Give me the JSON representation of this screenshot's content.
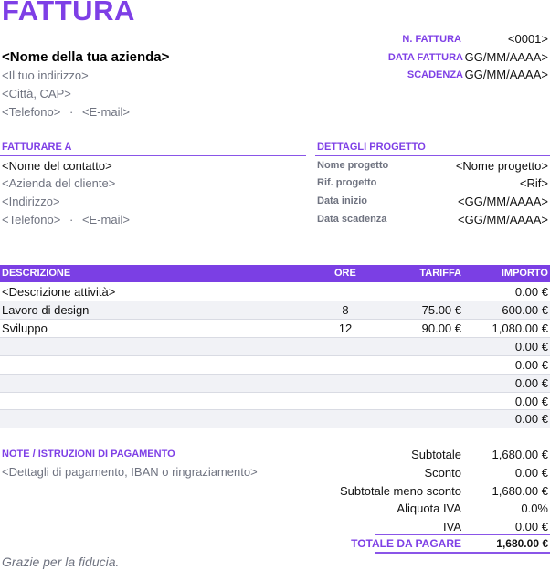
{
  "header": {
    "title": "FATTURA"
  },
  "company": {
    "name": "<Nome della tua azienda>",
    "address": "<Il tuo indirizzo>",
    "city": "<Città, CAP>",
    "phone": "<Telefono>",
    "sep": "·",
    "email": "<E-mail>"
  },
  "meta": {
    "number_label": "N. FATTURA",
    "number_value": "<0001>",
    "date_label": "DATA FATTURA",
    "date_value": "GG/MM/AAAA>",
    "due_label": "SCADENZA",
    "due_value": "GG/MM/AAAA>"
  },
  "bill_to": {
    "heading": "FATTURARE A",
    "contact": "<Nome del contatto>",
    "client_company": "<Azienda del cliente>",
    "address": "<Indirizzo>",
    "phone": "<Telefono>",
    "sep": "·",
    "email": "<E-mail>"
  },
  "project": {
    "heading": "DETTAGLI PROGETTO",
    "name_label": "Nome progetto",
    "name_value": "<Nome progetto>",
    "ref_label": "Rif. progetto",
    "ref_value": "<Rif>",
    "start_label": "Data inizio",
    "start_value": "<GG/MM/AAAA>",
    "due_label": "Data scadenza",
    "due_value": "<GG/MM/AAAA>"
  },
  "items": {
    "headers": {
      "desc": "DESCRIZIONE",
      "hours": "ORE",
      "rate": "TARIFFA",
      "amount": "IMPORTO"
    },
    "rows": [
      {
        "desc": "<Descrizione attività>",
        "hours": "",
        "rate": "",
        "amount": "0.00 €"
      },
      {
        "desc": "Lavoro di design",
        "hours": "8",
        "rate": "75.00 €",
        "amount": "600.00 €"
      },
      {
        "desc": "Sviluppo",
        "hours": "12",
        "rate": "90.00 €",
        "amount": "1,080.00 €"
      },
      {
        "desc": "",
        "hours": "",
        "rate": "",
        "amount": "0.00 €"
      },
      {
        "desc": "",
        "hours": "",
        "rate": "",
        "amount": "0.00 €"
      },
      {
        "desc": "",
        "hours": "",
        "rate": "",
        "amount": "0.00 €"
      },
      {
        "desc": "",
        "hours": "",
        "rate": "",
        "amount": "0.00 €"
      },
      {
        "desc": "",
        "hours": "",
        "rate": "",
        "amount": "0.00 €"
      }
    ]
  },
  "notes": {
    "heading": "NOTE / ISTRUZIONI DI PAGAMENTO",
    "text": "<Dettagli di pagamento, IBAN o ringraziamento>"
  },
  "summary": {
    "subtotal_label": "Subtotale",
    "subtotal_value": "1,680.00 €",
    "discount_label": "Sconto",
    "discount_value": "0.00 €",
    "net_label": "Subtotale meno sconto",
    "net_value": "1,680.00 €",
    "vat_rate_label": "Aliquota IVA",
    "vat_rate_value": "0.0%",
    "vat_label": "IVA",
    "vat_value": "0.00 €",
    "total_label": "TOTALE DA PAGARE",
    "total_value": "1,680.00 €"
  },
  "footer": {
    "thanks": "Grazie per la fiducia."
  },
  "colors": {
    "accent": "#7e3fe6",
    "header_bg": "#7b3fe4",
    "muted": "#6f7380",
    "stripe": "#f1f2f6"
  }
}
